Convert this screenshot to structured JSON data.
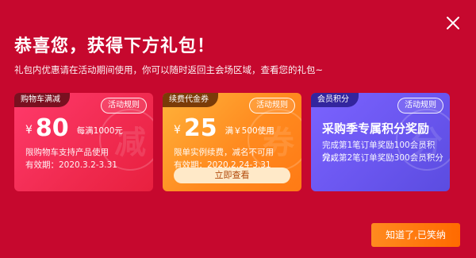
{
  "modal": {
    "title": "恭喜您，获得下方礼包！",
    "subtitle": "礼包内优惠请在活动期间使用，你可以随时返回主会场区域，查看您的礼包~",
    "ok_label": "知道了,已笑纳",
    "close_icon": "close-icon"
  },
  "cards": [
    {
      "badge": "购物车满减",
      "rule_label": "活动规则",
      "currency": "¥",
      "amount": "80",
      "condition": "每满1000元",
      "desc": "限购物车支持产品使用",
      "validity": "有效期：2020.3.2-3.31",
      "watermark": "减",
      "accent": "#f02a4f"
    },
    {
      "badge": "续费代金券",
      "rule_label": "活动规则",
      "currency": "¥",
      "amount": "25",
      "condition": "满￥500使用",
      "desc": "限单实例续费，减名不可用",
      "validity": "有效期：2020.2.24-3.31",
      "button_label": "立即查看",
      "watermark": "券",
      "accent": "#ff8a1f"
    },
    {
      "badge": "会员积分",
      "rule_label": "活动规则",
      "title": "采购季专属积分奖励",
      "line1": "完成第1笔订单奖励100会员积分，",
      "line2": "完成第2笔订单奖励300会员积分",
      "watermark": "分",
      "accent": "#6a56ef"
    }
  ],
  "colors": {
    "background": "#c6082e",
    "ok_button": "#ff6a00"
  }
}
